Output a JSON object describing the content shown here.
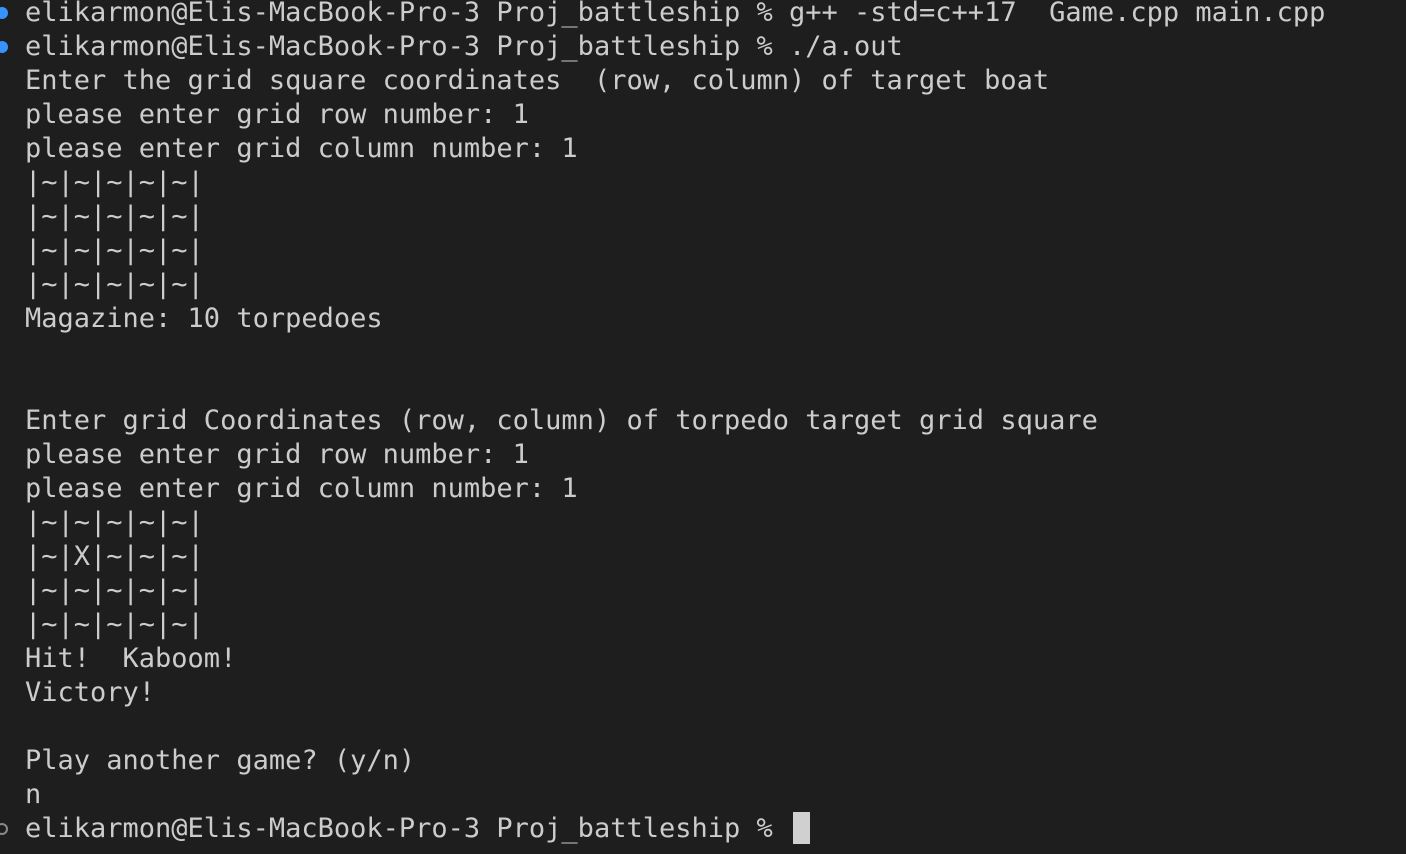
{
  "terminal": {
    "lines": [
      {
        "text": "elikarmon@Elis-MacBook-Pro-3 Proj_battleship % g++ -std=c++17  Game.cpp main.cpp",
        "decoration": "success"
      },
      {
        "text": "elikarmon@Elis-MacBook-Pro-3 Proj_battleship % ./a.out",
        "decoration": "success"
      },
      {
        "text": "Enter the grid square coordinates  (row, column) of target boat"
      },
      {
        "text": "please enter grid row number: 1"
      },
      {
        "text": "please enter grid column number: 1"
      },
      {
        "text": "|~|~|~|~|~|"
      },
      {
        "text": "|~|~|~|~|~|"
      },
      {
        "text": "|~|~|~|~|~|"
      },
      {
        "text": "|~|~|~|~|~|"
      },
      {
        "text": "Magazine: 10 torpedoes"
      },
      {
        "text": ""
      },
      {
        "text": ""
      },
      {
        "text": "Enter grid Coordinates (row, column) of torpedo target grid square"
      },
      {
        "text": "please enter grid row number: 1"
      },
      {
        "text": "please enter grid column number: 1"
      },
      {
        "text": "|~|~|~|~|~|"
      },
      {
        "text": "|~|X|~|~|~|"
      },
      {
        "text": "|~|~|~|~|~|"
      },
      {
        "text": "|~|~|~|~|~|"
      },
      {
        "text": "Hit!  Kaboom!"
      },
      {
        "text": "Victory!"
      },
      {
        "text": ""
      },
      {
        "text": "Play another game? (y/n)"
      },
      {
        "text": "n"
      }
    ],
    "prompt": {
      "text": "elikarmon@Elis-MacBook-Pro-3 Proj_battleship % ",
      "decoration": "none"
    }
  },
  "colors": {
    "background": "#1e1e1e",
    "foreground": "#cccccc",
    "success_decoration": "#3794ff",
    "cursor": "#d0d0d0"
  }
}
